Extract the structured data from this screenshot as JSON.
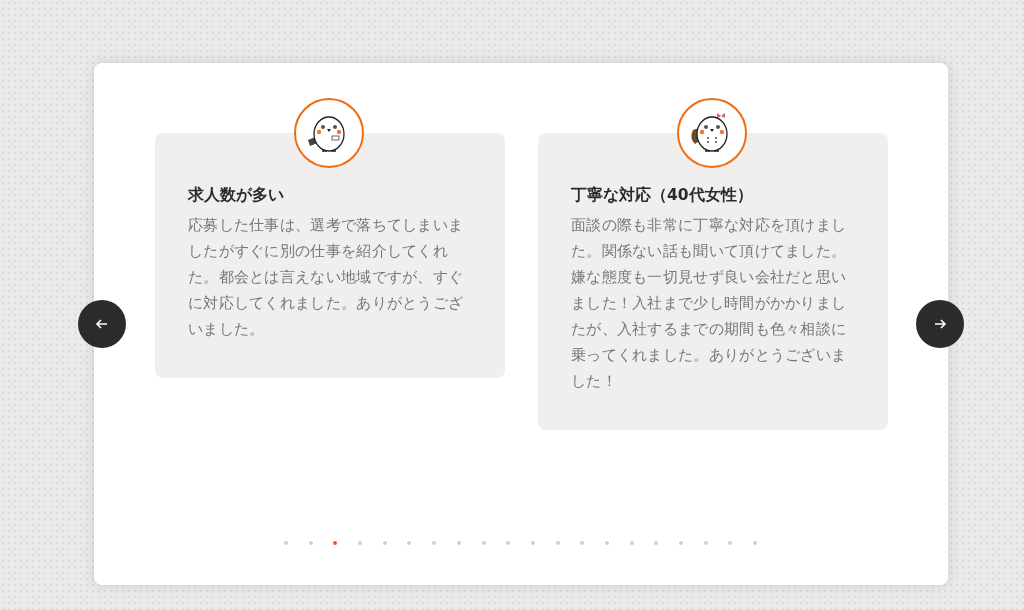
{
  "testimonials": [
    {
      "title": "求人数が多い",
      "body": "応募した仕事は、選考で落ちてしまいましたがすぐに別の仕事を紹介してくれた。都会とは言えない地域ですが、すぐに対応してくれました。ありがとうございました。",
      "kind": "briefcase"
    },
    {
      "title": "丁寧な対応（40代女性）",
      "body": "面談の際も非常に丁寧な対応を頂けました。関係ない話も聞いて頂けてました。嫌な態度も一切見せず良い会社だと思いました！入社まで少し時間がかかりましたが、入社するまでの期間も色々相談に乗ってくれました。ありがとうございました！",
      "kind": "bow"
    }
  ],
  "dots": [
    {
      "selected": false
    },
    {
      "selected": false
    },
    {
      "selected": true
    },
    {
      "selected": false
    },
    {
      "selected": false
    },
    {
      "selected": false
    },
    {
      "selected": false
    },
    {
      "selected": false
    },
    {
      "selected": false
    },
    {
      "selected": false
    },
    {
      "selected": false
    },
    {
      "selected": false
    },
    {
      "selected": false
    },
    {
      "selected": false
    },
    {
      "selected": false
    },
    {
      "selected": false
    },
    {
      "selected": false
    },
    {
      "selected": false
    },
    {
      "selected": false
    },
    {
      "selected": false
    }
  ]
}
